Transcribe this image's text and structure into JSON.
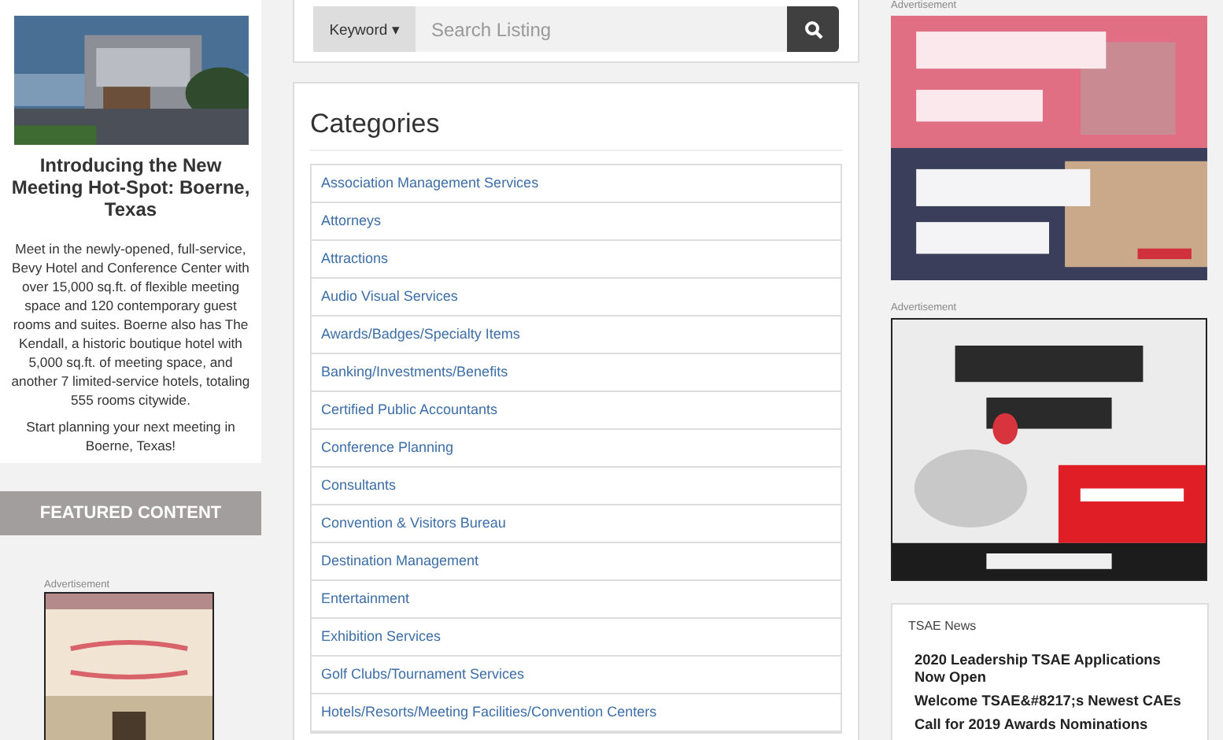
{
  "feature": {
    "image": {
      "kind": "picture"
    },
    "title": "Introducing the New Meeting Hot-Spot: Boerne, Texas",
    "paragraphs": [
      "Meet in the newly-opened, full-service, Bevy Hotel and Conference Center with over 15,000 sq.ft. of flexible meeting space and 120 contemporary guest rooms and suites.  Boerne also has The Kendall, a historic boutique hotel with 5,000 sq.ft. of meeting space, and another 7 limited-service hotels, totaling 555 rooms citywide.",
      "Start planning your next meeting in Boerne, Texas!"
    ]
  },
  "featured_bar": "FEATURED CONTENT",
  "left_ad": {
    "label": "Advertisement",
    "image": {
      "kind": "picture"
    }
  },
  "search": {
    "mode": "Keyword",
    "caret": "▾",
    "placeholder": "Search Listing"
  },
  "categories": {
    "title": "Categories",
    "items": [
      "Association Management Services",
      "Attorneys",
      "Attractions",
      "Audio Visual Services",
      "Awards/Badges/Specialty Items",
      "Banking/Investments/Benefits",
      "Certified Public Accountants",
      "Conference Planning",
      "Consultants",
      "Convention & Visitors Bureau",
      "Destination Management",
      "Entertainment",
      "Exhibition Services",
      "Golf Clubs/Tournament Services",
      "Hotels/Resorts/Meeting Facilities/Convention Centers"
    ]
  },
  "right_ads": [
    {
      "label": "Advertisement",
      "image": {
        "kind": "picture"
      }
    },
    {
      "label": "Advertisement",
      "image": {
        "kind": "picture"
      }
    }
  ],
  "news": {
    "title": "TSAE News",
    "items": [
      "2020 Leadership TSAE Applications Now Open",
      "Welcome TSAE&#8217;s Newest CAEs",
      "Call for 2019 Awards Nominations"
    ]
  }
}
